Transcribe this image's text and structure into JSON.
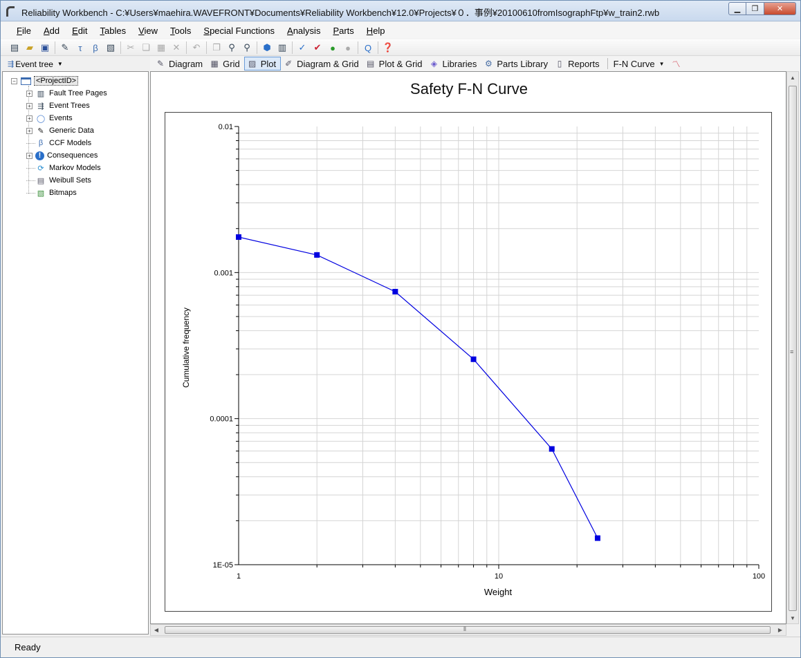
{
  "window": {
    "title": "Reliability Workbench - C:¥Users¥maehira.WAVEFRONT¥Documents¥Reliability Workbench¥12.0¥Projects¥０．事例¥20100610fromIsographFtp¥w_train2.rwb"
  },
  "menu": [
    {
      "label": "File",
      "key": "F",
      "rest": "ile"
    },
    {
      "label": "Add",
      "key": "A",
      "rest": "dd"
    },
    {
      "label": "Edit",
      "key": "E",
      "rest": "dit"
    },
    {
      "label": "Tables",
      "key": "T",
      "rest": "ables"
    },
    {
      "label": "View",
      "key": "V",
      "rest": "iew"
    },
    {
      "label": "Tools",
      "key": "T",
      "rest": "ools"
    },
    {
      "label": "Special Functions",
      "key": "S",
      "rest": "pecial Functions"
    },
    {
      "label": "Analysis",
      "key": "A",
      "rest": "nalysis"
    },
    {
      "label": "Parts",
      "key": "P",
      "rest": "arts"
    },
    {
      "label": "Help",
      "key": "H",
      "rest": "elp"
    }
  ],
  "tree_header": {
    "label": "Event tree"
  },
  "view_tabs": {
    "diagram": "Diagram",
    "grid": "Grid",
    "plot": "Plot",
    "diagram_grid": "Diagram & Grid",
    "plot_grid": "Plot & Grid",
    "libraries": "Libraries",
    "parts_library": "Parts Library",
    "reports": "Reports",
    "fn_curve": "F-N Curve"
  },
  "tree": {
    "root": "<ProjectID>",
    "items": [
      {
        "label": "Fault Tree Pages",
        "expandable": true,
        "icon": "fault-tree-icon"
      },
      {
        "label": "Event Trees",
        "expandable": true,
        "icon": "event-tree-icon"
      },
      {
        "label": "Events",
        "expandable": true,
        "icon": "events-icon"
      },
      {
        "label": "Generic Data",
        "expandable": true,
        "icon": "generic-data-icon"
      },
      {
        "label": "CCF Models",
        "expandable": false,
        "icon": "beta-icon"
      },
      {
        "label": "Consequences",
        "expandable": true,
        "icon": "consequences-icon"
      },
      {
        "label": "Markov Models",
        "expandable": false,
        "icon": "markov-icon"
      },
      {
        "label": "Weibull Sets",
        "expandable": false,
        "icon": "weibull-icon"
      },
      {
        "label": "Bitmaps",
        "expandable": false,
        "icon": "bitmap-icon"
      }
    ]
  },
  "status": {
    "text": "Ready"
  },
  "colors": {
    "series": "#0000e0",
    "grid": "#d4d4d4"
  },
  "chart_data": {
    "type": "line",
    "title": "Safety F-N Curve",
    "xlabel": "Weight",
    "ylabel": "Cumulative frequency",
    "xscale": "log",
    "yscale": "log",
    "xlim": [
      1,
      100
    ],
    "ylim": [
      1e-05,
      0.01
    ],
    "x_tick_labels": [
      {
        "value": 1,
        "label": "1"
      },
      {
        "value": 10,
        "label": "10"
      },
      {
        "value": 100,
        "label": "100"
      }
    ],
    "y_tick_labels": [
      {
        "value": 0.01,
        "label": "0.01"
      },
      {
        "value": 0.001,
        "label": "0.001"
      },
      {
        "value": 0.0001,
        "label": "0.0001"
      },
      {
        "value": 1e-05,
        "label": "1E-05"
      }
    ],
    "grid": true,
    "series": [
      {
        "x": [
          1,
          2,
          4,
          8,
          16,
          24
        ],
        "y": [
          0.00175,
          0.00132,
          0.00074,
          0.000255,
          6.2e-05,
          1.52e-05
        ]
      }
    ]
  }
}
